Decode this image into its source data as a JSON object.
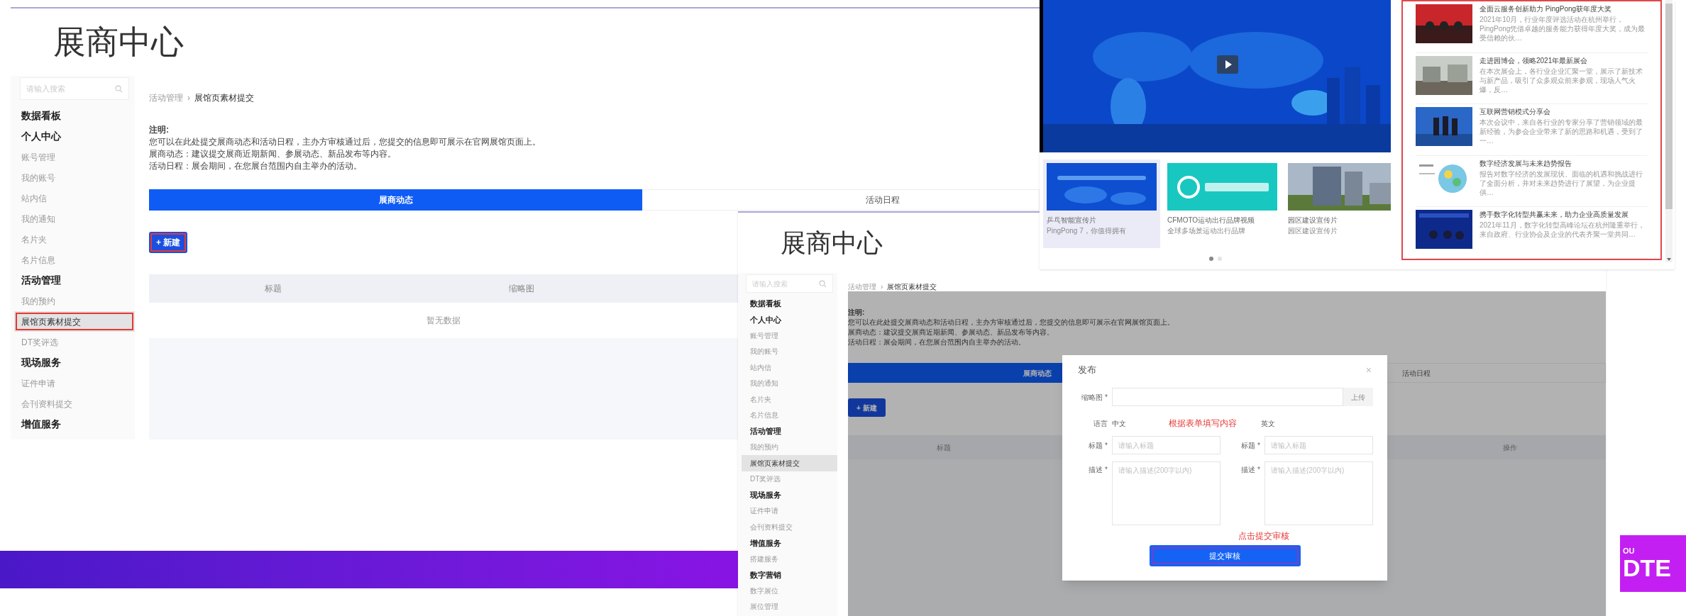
{
  "exhibitor_page": {
    "title": "展商中心",
    "search_placeholder": "请输入搜索",
    "sidebar": [
      {
        "label": "数据看板",
        "kind": "heading",
        "selected": false,
        "annotated": false
      },
      {
        "label": "个人中心",
        "kind": "heading",
        "selected": false,
        "annotated": false
      },
      {
        "label": "账号管理",
        "kind": "link",
        "selected": false,
        "annotated": false
      },
      {
        "label": "我的账号",
        "kind": "link",
        "selected": false,
        "annotated": false
      },
      {
        "label": "站内信",
        "kind": "link",
        "selected": false,
        "annotated": false
      },
      {
        "label": "我的通知",
        "kind": "link",
        "selected": false,
        "annotated": false
      },
      {
        "label": "名片夹",
        "kind": "link",
        "selected": false,
        "annotated": false
      },
      {
        "label": "名片信息",
        "kind": "link",
        "selected": false,
        "annotated": false
      },
      {
        "label": "活动管理",
        "kind": "heading",
        "selected": false,
        "annotated": false
      },
      {
        "label": "我的预约",
        "kind": "link",
        "selected": false,
        "annotated": false
      },
      {
        "label": "展馆页素材提交",
        "kind": "link",
        "selected": true,
        "annotated": true
      },
      {
        "label": "DT奖评选",
        "kind": "link",
        "selected": false,
        "annotated": false
      },
      {
        "label": "现场服务",
        "kind": "heading",
        "selected": false,
        "annotated": false
      },
      {
        "label": "证件申请",
        "kind": "link",
        "selected": false,
        "annotated": false
      },
      {
        "label": "会刊资料提交",
        "kind": "link",
        "selected": false,
        "annotated": false
      },
      {
        "label": "增值服务",
        "kind": "heading",
        "selected": false,
        "annotated": false
      }
    ],
    "breadcrumb": {
      "parent": "活动管理",
      "separator": "›",
      "current": "展馆页素材提交"
    },
    "notes": {
      "heading": "注明:",
      "lines": [
        "您可以在此处提交展商动态和活动日程，主办方审核通过后，您提交的信息即可展示在官网展馆页面上。",
        "展商动态：建议提交展商近期新闻、参展动态、新品发布等内容。",
        "活动日程：展会期间，在您展台范围内自主举办的活动。"
      ]
    },
    "tabs": [
      {
        "label": "展商动态",
        "selected": true
      },
      {
        "label": "活动日程",
        "selected": false
      }
    ],
    "new_button": {
      "label": "+ 新建",
      "annotated": true
    },
    "table": {
      "columns": [
        "标题",
        "缩略图"
      ],
      "empty_text": "暂无数据"
    }
  },
  "media_page": {
    "cards": [
      {
        "title": "乒乓智能宣传片",
        "subtitle": "PingPong 7，你值得拥有",
        "selected": true
      },
      {
        "title": "CFMOTO运动出行品牌视频",
        "subtitle": "全球多场景运动出行品牌",
        "selected": false
      },
      {
        "title": "园区建设宣传片",
        "subtitle": "园区建设宣传片",
        "selected": false
      }
    ],
    "pager": [
      {
        "selected": true
      },
      {
        "selected": false
      }
    ],
    "news": [
      {
        "title": "全面云服务创新助力 PingPong获年度大奖",
        "summary": "2021年10月，行业年度评选活动在杭州举行，PingPong凭借卓越的服务能力获得年度大奖，成为最受信赖的伙…"
      },
      {
        "title": "走进园博会，领略2021年最新展会",
        "summary": "在本次展会上，各行业企业汇聚一堂，展示了新技术与新产品，吸引了众多观众前来参观，现场人气火爆，反…"
      },
      {
        "title": "互联网营销模式分享会",
        "summary": "本次会议中，来自各行业的专家分享了营销领域的最新经验，为参会企业带来了新的思路和机遇，受到了一…"
      },
      {
        "title": "数字经济发展与未来趋势报告",
        "summary": "报告对数字经济的发展现状、面临的机遇和挑战进行了全面分析，并对未来趋势进行了展望，为企业提供…"
      },
      {
        "title": "携手数字化转型共赢未来，助力企业高质量发展",
        "summary": "2021年11月，数字化转型高峰论坛在杭州隆重举行，来自政府、行业协会及企业的代表齐聚一堂共同…"
      }
    ]
  },
  "submit_page": {
    "title": "展商中心",
    "search_placeholder": "请输入搜索",
    "sidebar": [
      {
        "label": "数据看板",
        "kind": "heading",
        "selected": false,
        "annotated": false
      },
      {
        "label": "个人中心",
        "kind": "heading",
        "selected": false,
        "annotated": false
      },
      {
        "label": "账号管理",
        "kind": "link",
        "selected": false,
        "annotated": false
      },
      {
        "label": "我的账号",
        "kind": "link",
        "selected": false,
        "annotated": false
      },
      {
        "label": "站内信",
        "kind": "link",
        "selected": false,
        "annotated": false
      },
      {
        "label": "我的通知",
        "kind": "link",
        "selected": false,
        "annotated": false
      },
      {
        "label": "名片夹",
        "kind": "link",
        "selected": false,
        "annotated": false
      },
      {
        "label": "名片信息",
        "kind": "link",
        "selected": false,
        "annotated": false
      },
      {
        "label": "活动管理",
        "kind": "heading",
        "selected": false,
        "annotated": false
      },
      {
        "label": "我的预约",
        "kind": "link",
        "selected": false,
        "annotated": false
      },
      {
        "label": "展馆页素材提交",
        "kind": "link",
        "selected": true,
        "annotated": false
      },
      {
        "label": "DT奖评选",
        "kind": "link",
        "selected": false,
        "annotated": false
      },
      {
        "label": "现场服务",
        "kind": "heading",
        "selected": false,
        "annotated": false
      },
      {
        "label": "证件申请",
        "kind": "link",
        "selected": false,
        "annotated": false
      },
      {
        "label": "会刊资料提交",
        "kind": "link",
        "selected": false,
        "annotated": false
      },
      {
        "label": "增值服务",
        "kind": "heading",
        "selected": false,
        "annotated": false
      },
      {
        "label": "搭建服务",
        "kind": "link",
        "selected": false,
        "annotated": false
      },
      {
        "label": "数字营销",
        "kind": "heading",
        "selected": false,
        "annotated": false
      },
      {
        "label": "数字展位",
        "kind": "link",
        "selected": false,
        "annotated": false
      },
      {
        "label": "展位管理",
        "kind": "link",
        "selected": false,
        "annotated": false
      }
    ],
    "breadcrumb": {
      "parent": "活动管理",
      "separator": "›",
      "current": "展馆页素材提交"
    },
    "notes": {
      "heading": "注明:",
      "lines": [
        "您可以在此处提交展商动态和活动日程，主办方审核通过后，您提交的信息即可展示在官网展馆页面上。",
        "展商动态：建议提交展商近期新闻、参展动态、新品发布等内容。",
        "活动日程：展会期间，在您展台范围内自主举办的活动。"
      ]
    },
    "tabs": [
      {
        "label": "展商动态",
        "selected": true
      },
      {
        "label": "活动日程",
        "selected": false
      }
    ],
    "new_button": {
      "label": "+ 新建",
      "annotated": false
    },
    "table": {
      "columns": [
        "标题",
        "操作"
      ]
    },
    "dialog": {
      "title": "发布",
      "close": "×",
      "thumbnail": {
        "label": "缩略图 *",
        "upload_button": "上传"
      },
      "language": {
        "label": "语言",
        "options": [
          "中文",
          "英文"
        ]
      },
      "columns": [
        {
          "title_label": "标题 *",
          "title_placeholder": "请输入标题",
          "desc_label": "描述 *",
          "desc_placeholder": "请输入描述(200字以内)"
        },
        {
          "title_label": "标题 *",
          "title_placeholder": "请输入标题",
          "desc_label": "描述 *",
          "desc_placeholder": "请输入描述(200字以内)"
        }
      ],
      "annotations": [
        "根据表单填写内容",
        "点击提交审核"
      ],
      "submit_button": {
        "label": "提交审核",
        "annotated": true
      }
    }
  },
  "slide": {
    "logo_fragment": {
      "small": "OU",
      "large": "DTE"
    }
  }
}
